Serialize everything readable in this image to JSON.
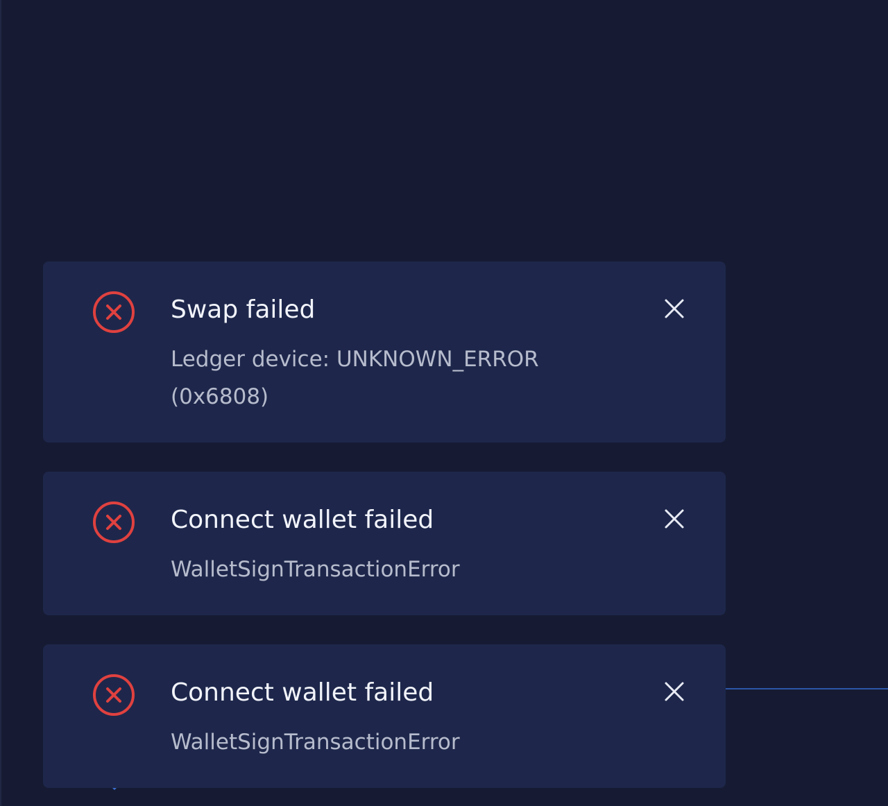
{
  "colors": {
    "page_background": "#161b33",
    "toast_background": "#1e274b",
    "error_red": "#e0413f",
    "title_text": "#f2f4fb",
    "message_text": "#b7bccd",
    "accent_line": "#2b57a8"
  },
  "toasts": [
    {
      "status_icon": "error-circle-x-icon",
      "title": "Swap failed",
      "message": "Ledger device: UNKNOWN_ERROR (0x6808)",
      "close_icon": "close-icon"
    },
    {
      "status_icon": "error-circle-x-icon",
      "title": "Connect wallet failed",
      "message": "WalletSignTransactionError",
      "close_icon": "close-icon"
    },
    {
      "status_icon": "error-circle-x-icon",
      "title": "Connect wallet failed",
      "message": "WalletSignTransactionError",
      "close_icon": "close-icon"
    }
  ]
}
